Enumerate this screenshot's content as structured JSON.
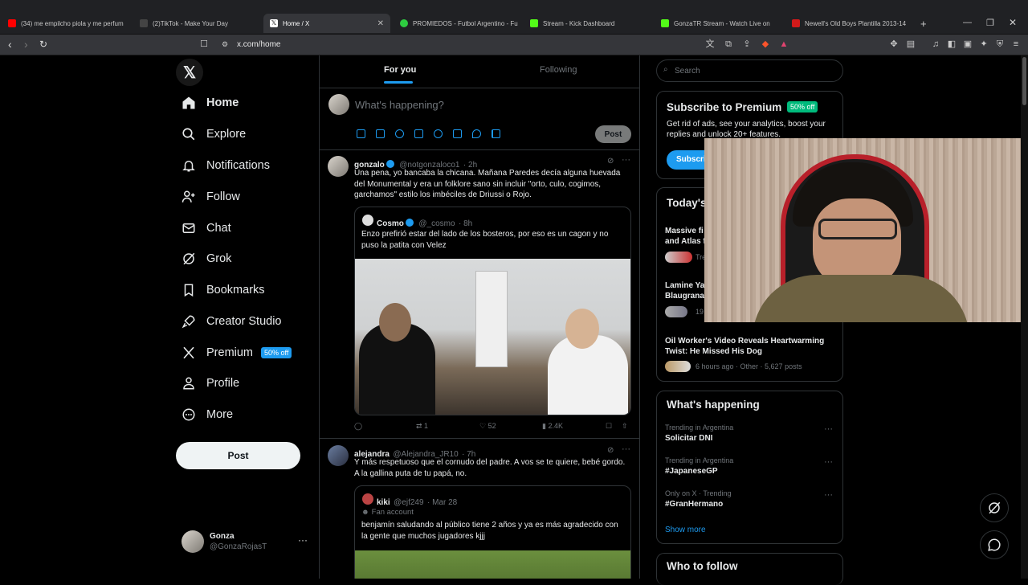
{
  "browser": {
    "tabs": [
      {
        "title": "(34) me empilcho piola y me perfum",
        "color": "#ff0000"
      },
      {
        "title": "(2)TikTok - Make Your Day",
        "color": "#222222"
      },
      {
        "title": "Home / X",
        "color": "#000000"
      },
      {
        "title": "PROMIEDOS - Futbol Argentino - Fu",
        "color": "#2ecc40"
      },
      {
        "title": "Stream - Kick Dashboard",
        "color": "#53fc18"
      },
      {
        "title": "GonzaTR Stream - Watch Live on",
        "color": "#53fc18"
      },
      {
        "title": "Newell's Old Boys Plantilla 2013-14",
        "color": "#d31a1a"
      }
    ],
    "new_tab": "+",
    "url": "x.com/home"
  },
  "nav": {
    "items": [
      {
        "label": "Home"
      },
      {
        "label": "Explore"
      },
      {
        "label": "Notifications"
      },
      {
        "label": "Follow"
      },
      {
        "label": "Chat"
      },
      {
        "label": "Grok"
      },
      {
        "label": "Bookmarks"
      },
      {
        "label": "Creator Studio"
      },
      {
        "label": "Premium",
        "badge": "50% off"
      },
      {
        "label": "Profile"
      },
      {
        "label": "More"
      }
    ],
    "post_label": "Post",
    "account": {
      "name": "Gonza",
      "handle": "@GonzaRojasT"
    }
  },
  "feed": {
    "tabs": [
      "For you",
      "Following"
    ],
    "compose_placeholder": "What's happening?",
    "post_label": "Post",
    "posts": [
      {
        "name": "gonzalo",
        "handle": "@notgonzaloco1",
        "time": "· 2h",
        "text": "Una pena, yo bancaba la chicana. Mañana Paredes decía alguna huevada del Monumental y era un folklore sano sin incluir \"orto, culo, cogimos, garchamos\" estilo los imbéciles de Driussi o Rojo.",
        "quote": {
          "name": "Cosmo",
          "handle": "@_cosmo",
          "time": "· 8h",
          "text": "Enzo prefirió estar del lado de los bosteros, por eso es un cagon y no puso la patita con Velez"
        },
        "stats": {
          "replies": "",
          "reposts": "1",
          "likes": "52",
          "views": "2.4K"
        }
      },
      {
        "name": "alejandra",
        "handle": "@Alejandra_JR10",
        "time": "· 7h",
        "text": "Y más respetuoso que el cornudo del padre. A vos se te quiere, bebé gordo. A la gallina puta de tu papá, no.",
        "quote": {
          "name": "kiki",
          "handle": "@ejf249",
          "time": "· Mar 28",
          "label": "Fan account",
          "text": "benjamín saludando al público tiene 2 años y ya es más agradecido con la gente que muchos jugadores kjjj"
        }
      }
    ]
  },
  "sidebar": {
    "search_placeholder": "Search",
    "premium": {
      "title": "Subscribe to Premium",
      "badge": "50% off",
      "text": "Get rid of ads, see your analytics, boost your replies and unlock 20+ features.",
      "button": "Subscribe"
    },
    "news": {
      "title": "Today's News",
      "items": [
        {
          "title": "Massive fi",
          "title2": "and Atlas f",
          "meta": "Tre"
        },
        {
          "title": "Lamine Ya",
          "title2": "Blaugrana",
          "meta": "19"
        },
        {
          "title": "Oil Worker's Video Reveals Heartwarming Twist: He Missed His Dog",
          "meta": "6 hours ago · Other · 5,627 posts"
        }
      ]
    },
    "happening": {
      "title": "What's happening",
      "items": [
        {
          "context": "Trending in Argentina",
          "title": "Solicitar DNI"
        },
        {
          "context": "Trending in Argentina",
          "title": "#JapaneseGP"
        },
        {
          "context": "Only on X · Trending",
          "title": "#GranHermano"
        }
      ],
      "show_more": "Show more"
    },
    "who_to_follow": "Who to follow"
  },
  "colors": {
    "accent": "#1d9bf0",
    "background": "#000000",
    "border": "#2f3336"
  }
}
